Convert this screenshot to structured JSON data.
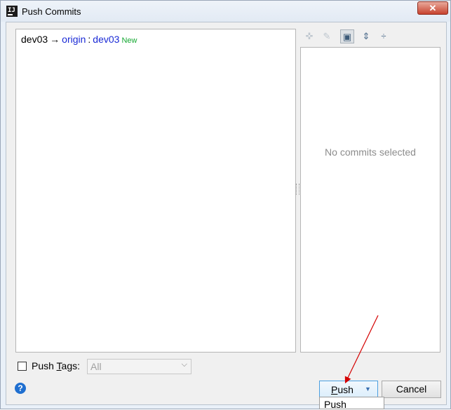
{
  "window": {
    "title": "Push Commits",
    "close_label": "✕"
  },
  "push": {
    "local_branch": "dev03",
    "arrow": "→",
    "remote": "origin",
    "separator": ":",
    "remote_branch": "dev03",
    "badge": "New"
  },
  "details": {
    "empty_text": "No commits selected"
  },
  "toolbar": {
    "buttons": [
      {
        "icon": "cherry-pick-icon",
        "glyph": "✜"
      },
      {
        "icon": "edit-source-icon",
        "glyph": "✎"
      },
      {
        "icon": "show-details-icon",
        "glyph": "▣"
      },
      {
        "icon": "expand-all-icon",
        "glyph": "⇕"
      },
      {
        "icon": "collapse-all-icon",
        "glyph": "÷"
      }
    ]
  },
  "tags": {
    "label_prefix": "Push ",
    "label_mnemonic": "T",
    "label_suffix": "ags:",
    "select_value": "All"
  },
  "buttons": {
    "push_mnemonic": "P",
    "push_rest": "ush",
    "cancel": "Cancel"
  },
  "dropdown": {
    "items": [
      "Push"
    ]
  },
  "colors": {
    "remote": "#1a2ad6",
    "new_badge": "#15a832",
    "annotation_arrow": "#d40000"
  }
}
